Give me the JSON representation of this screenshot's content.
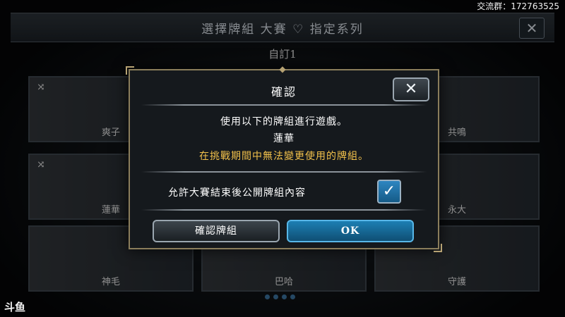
{
  "overlay": {
    "stream_group": "交流群：172763525",
    "watermark": "斗鱼"
  },
  "header": {
    "title": "選擇牌組 大賽 ♡ 指定系列",
    "close_symbol": "✕"
  },
  "deck_set": {
    "name": "自訂1"
  },
  "decks": [
    {
      "name": "爽子",
      "shuffle": "⤨"
    },
    {
      "name": "",
      "shuffle": ""
    },
    {
      "name": "共鳴",
      "shuffle": ""
    },
    {
      "name": "蓮華",
      "shuffle": "⤨"
    },
    {
      "name": "",
      "shuffle": ""
    },
    {
      "name": "永大",
      "shuffle": ""
    },
    {
      "name": "神毛",
      "shuffle": ""
    },
    {
      "name": "巴哈",
      "shuffle": ""
    },
    {
      "name": "守護",
      "shuffle": ""
    }
  ],
  "modal": {
    "title": "確認",
    "close_symbol": "✕",
    "message_line1": "使用以下的牌組進行遊戲。",
    "deck_name": "蓮華",
    "warning": "在挑戰期間中無法變更使用的牌組。",
    "option_label": "允許大賽結束後公開牌組內容",
    "checkbox_checked": "✓",
    "button_confirm_deck": "確認牌組",
    "button_ok": "OK"
  },
  "pagination": {
    "dots": 4
  },
  "colors": {
    "warning_text": "#f2c14b",
    "accent_blue": "#1d7fb3",
    "frame_gold": "#8a7d5b"
  }
}
